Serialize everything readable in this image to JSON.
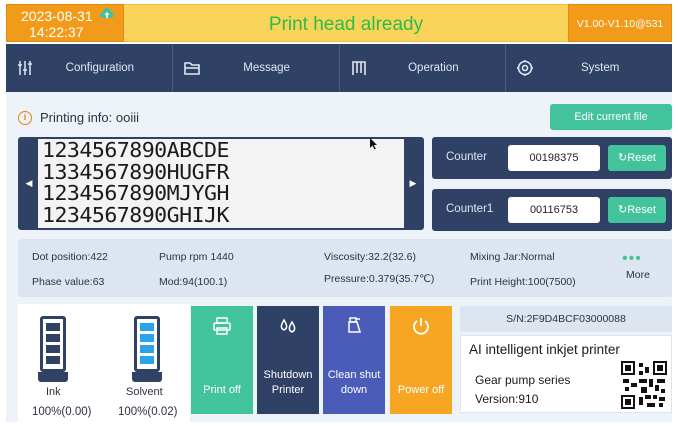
{
  "status_bar": {
    "date": "2023-08-31",
    "time": "14:22:37",
    "status": "Print head already",
    "version": "V1.00-V1.10@531"
  },
  "nav": [
    {
      "label": "Configuration",
      "icon": "sliders-icon"
    },
    {
      "label": "Message",
      "icon": "folder-icon"
    },
    {
      "label": "Operation",
      "icon": "printhead-icon"
    },
    {
      "label": "System",
      "icon": "gear-icon"
    }
  ],
  "printing": {
    "info_label": "Printing info: ooiii",
    "edit_button": "Edit current file",
    "lines": [
      "1234567890ABCDE",
      "1334567890HUGFR",
      "1234567890MJYGH",
      "1234567890GHIJK"
    ]
  },
  "counters": [
    {
      "label": "Counter",
      "value": "00198375",
      "reset": "Reset"
    },
    {
      "label": "Counter1",
      "value": "00116753",
      "reset": "Reset"
    }
  ],
  "params": {
    "dot_position": "Dot position:422",
    "pump_rpm": "Pump rpm 1440",
    "viscosity": "Viscosity:32.2(32.6)",
    "mixing_jar": "Mixing Jar:Normal",
    "phase_value": "Phase value:63",
    "mod": "Mod:94(100.1)",
    "pressure": "Pressure:0.379(35.7℃)",
    "print_height": "Print Height:100(7500)",
    "more": "More"
  },
  "tanks": {
    "ink": {
      "label": "Ink",
      "value": "100%(0.00)",
      "level": 1.0
    },
    "solvent": {
      "label": "Solvent",
      "value": "100%(0.02)",
      "level": 1.0
    }
  },
  "actions": [
    {
      "label": "Print off",
      "icon": "printer-icon",
      "color": "#43c39b"
    },
    {
      "label": "Shutdown Printer",
      "icon": "drops-icon",
      "color": "#2f4266"
    },
    {
      "label": "Clean shut down",
      "icon": "spray-bottle-icon",
      "color": "#4a5cb8"
    },
    {
      "label": "Power off",
      "icon": "power-icon",
      "color": "#f6a623"
    }
  ],
  "device": {
    "serial": "S/N:2F9D4BCF03000088",
    "title": "AI intelligent inkjet printer",
    "series": "Gear pump series",
    "version": "Version:910"
  },
  "colors": {
    "accent_orange": "#f29b1a",
    "status_yellow": "#f9d35a",
    "status_green": "#2fbb4c",
    "nav_navy": "#2f4266",
    "teal": "#43c39b"
  }
}
